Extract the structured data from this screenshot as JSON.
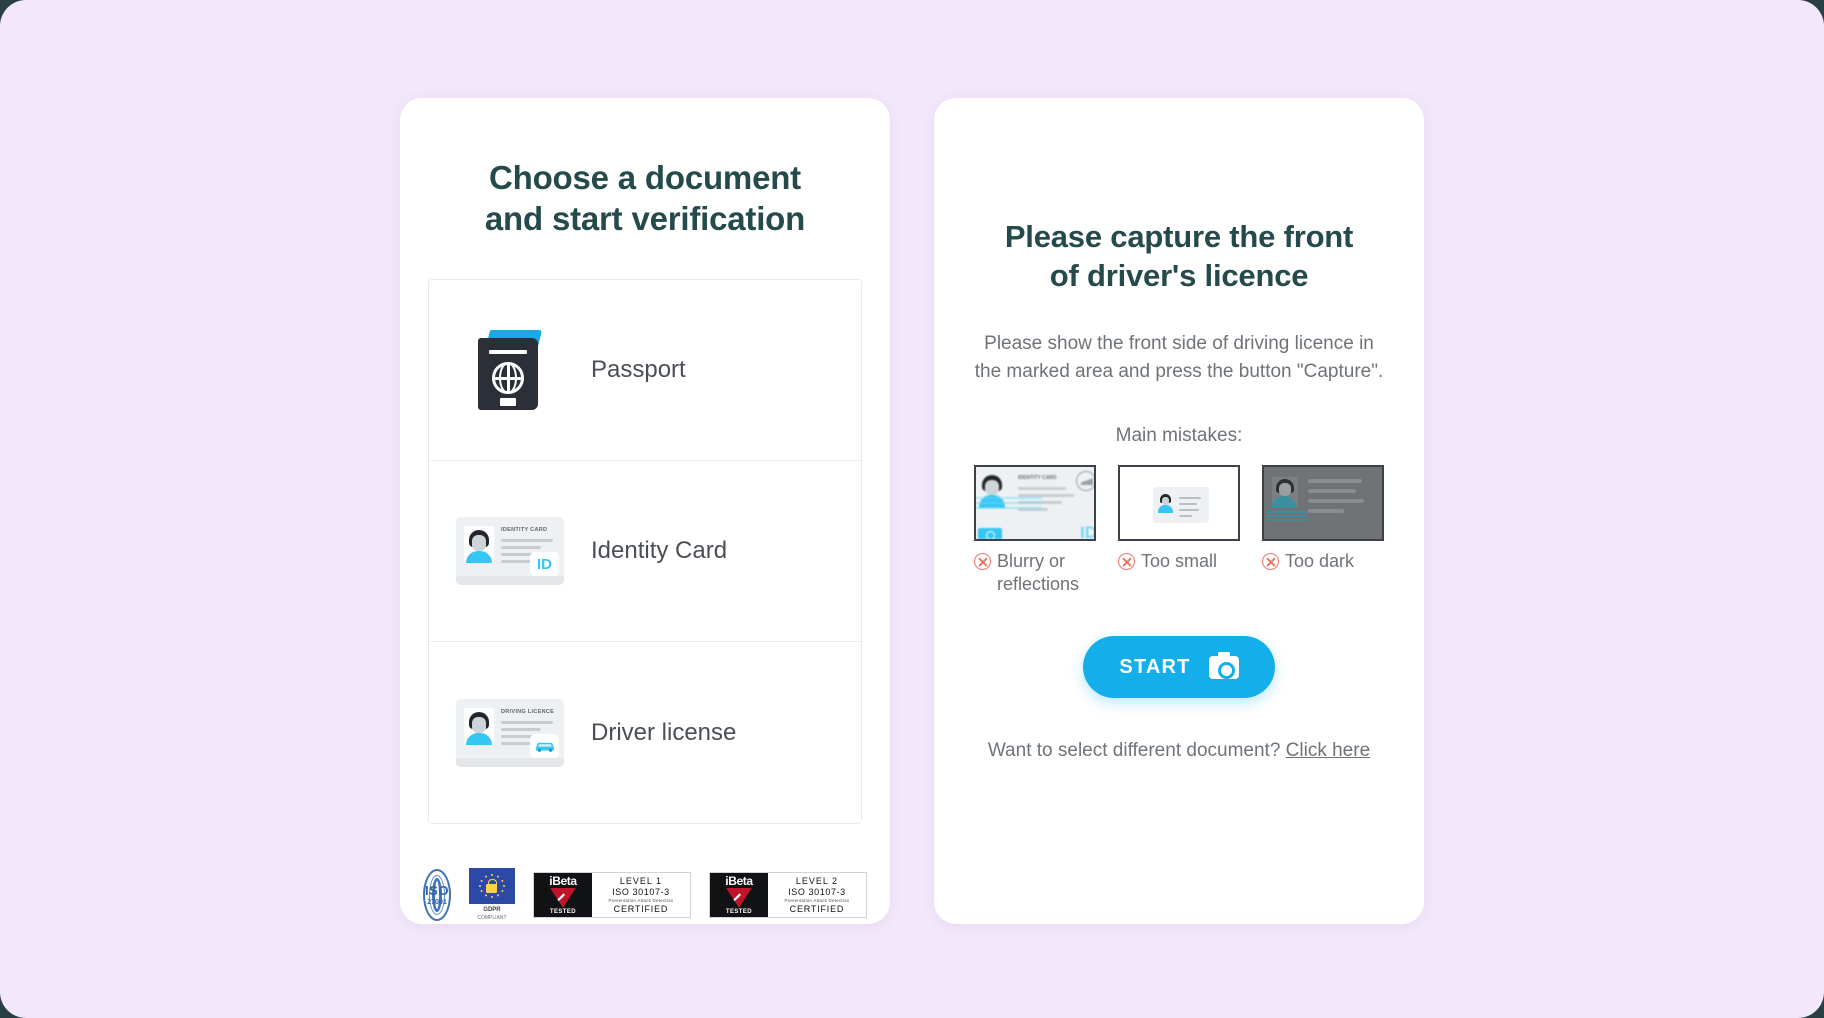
{
  "background_color": "#f3e7fa",
  "left_panel": {
    "title_line1": "Choose a document",
    "title_line2": "and start verification",
    "documents": [
      {
        "label": "Passport",
        "icon": "passport-icon"
      },
      {
        "label": "Identity Card",
        "icon": "identity-card-icon",
        "card_heading": "IDENTITY CARD",
        "badge": "ID"
      },
      {
        "label": "Driver license",
        "icon": "driver-license-icon",
        "card_heading": "DRIVING LICENCE",
        "badge": "car"
      }
    ],
    "certifications": [
      {
        "type": "iso-seal",
        "name": "ISO",
        "number": "27001",
        "ring_top": "Security",
        "ring_bottom": "Certified"
      },
      {
        "type": "gdpr",
        "title": "GDPR",
        "subtitle": "COMPLIANT"
      },
      {
        "type": "ibeta",
        "brand": "iBeta",
        "tested": "TESTED",
        "level": "LEVEL 1",
        "standard": "ISO 30107-3",
        "detection": "Presentation Attack Detection",
        "certified": "CERTIFIED"
      },
      {
        "type": "ibeta",
        "brand": "iBeta",
        "tested": "TESTED",
        "level": "LEVEL 2",
        "standard": "ISO 30107-3",
        "detection": "Presentation Attack Detection",
        "certified": "CERTIFIED"
      }
    ]
  },
  "right_panel": {
    "title": "Please capture the front of driver's licence",
    "instructions": "Please show the front side of driving licence in the marked area and press the button \"Capture\".",
    "mistakes_label": "Main mistakes:",
    "mistakes": [
      {
        "caption": "Blurry or reflections",
        "thumb": "blurry-card-thumb",
        "card_heading": "IDENTITY CARD",
        "badge": "ID"
      },
      {
        "caption": "Too small",
        "thumb": "small-card-thumb"
      },
      {
        "caption": "Too dark",
        "thumb": "dark-card-thumb"
      }
    ],
    "start_button": {
      "label": "START",
      "icon": "camera-icon"
    },
    "footer_text": "Want to select different document?",
    "footer_link": "Click here"
  },
  "colors": {
    "heading": "#254a4c",
    "body_text": "#6e7378",
    "accent_blue": "#14aeeb",
    "error_red": "#e8776a"
  }
}
